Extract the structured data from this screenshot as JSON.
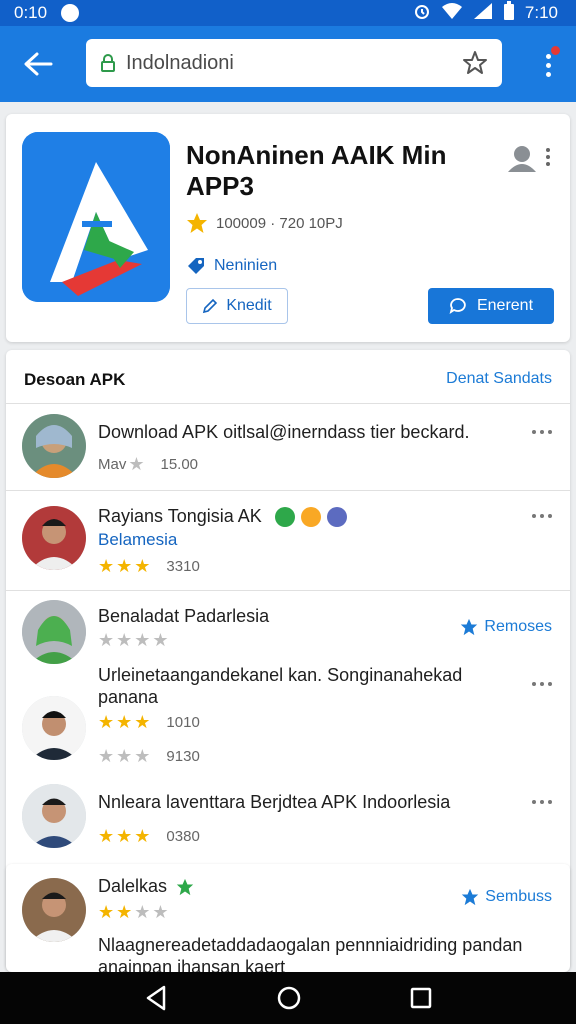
{
  "status_bar": {
    "time_left": "0:10",
    "time_right": "7:10"
  },
  "browser": {
    "url": "Indolnadioni"
  },
  "app": {
    "title": "NonAninen AAIK Min APP3",
    "rating_text": "100009 · 720 10PJ",
    "verified_label": "Neninien",
    "secondary_button": "Knedit",
    "primary_button": "Enerent",
    "colors": {
      "accent": "#1876d8",
      "header": "#1b7be0"
    }
  },
  "reviews": {
    "title": "Desoan APK",
    "header_link": "Denat Sandats",
    "items": [
      {
        "text": "Download APK oitlsal@inerndass tier beckard.",
        "sub_label": "",
        "stars_on": 0,
        "stars_prefix": "Mav",
        "count": "15.00",
        "action": "more"
      },
      {
        "text": "Rayians Tongisia AK",
        "sub_label": "Belamesia",
        "stars_on": 3,
        "count": "3310",
        "action": "more"
      },
      {
        "text": "Benaladat Padarlesia",
        "sub_label": "",
        "stars_on": 0,
        "count": "",
        "action": "Remoses"
      },
      {
        "text": "Urleinetaangandekanel kan. Songinanahekad panana",
        "sub_label": "",
        "stars_on": 3,
        "count": "1010",
        "action": "more"
      },
      {
        "text": "",
        "sub_label": "",
        "stars_on": 0,
        "count": "9130",
        "action": ""
      },
      {
        "text": "Nnleara laventtara Berjdtea APK Indoorlesia",
        "sub_label": "",
        "stars_on": 3,
        "count": "0380",
        "action": "more"
      },
      {
        "text": "Dalelkas",
        "sub_label": "",
        "stars_on": 2,
        "count": "",
        "action": "Sembuss"
      },
      {
        "text": "Nlaagnereadetaddadaogalan pennniaidriding pandan anainpan ihansan kaert",
        "sub_label": "",
        "stars_on": 0,
        "count": "",
        "action": ""
      }
    ]
  }
}
